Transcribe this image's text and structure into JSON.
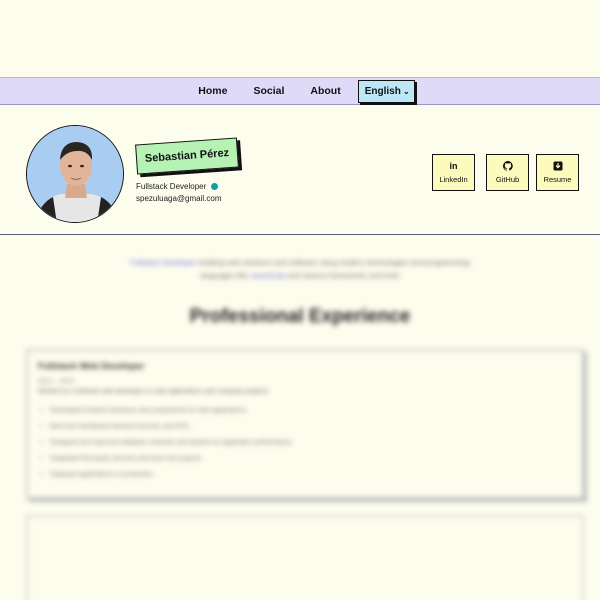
{
  "nav": {
    "links": [
      "Home",
      "Social",
      "About"
    ],
    "language": {
      "selected": "English",
      "icon": "chevron-down-icon"
    }
  },
  "profile": {
    "name": "Sebastian Pérez",
    "role": "Fullstack Developer",
    "email": "spezuluaga@gmail.com",
    "status_color": "#1a9aa1"
  },
  "social": [
    {
      "label": "LinkedIn",
      "icon": "linkedin-icon"
    },
    {
      "label": "GitHub",
      "icon": "github-icon"
    },
    {
      "label": "Resume",
      "icon": "download-icon"
    }
  ],
  "intro": {
    "link_text": "Fullstack Developer",
    "text": "building web solutions and software using modern technologies and programming",
    "text2": "languages like",
    "link2": "JavaScript",
    "text3": "and various frameworks and tools"
  },
  "experience": {
    "title": "Professional Experience",
    "jobs": [
      {
        "title": "Fullstack Web Developer",
        "dates": "2021 – 2023",
        "description": "Worked as a fullstack web developer on web applications and company projects.",
        "bullets": [
          "Developed frontend interfaces and components for web applications.",
          "Built and maintained backend services and APIs.",
          "Designed and improved database schemas and queries for application performance.",
          "Integrated third-party services and tools into projects.",
          "Deployed applications to production."
        ]
      }
    ]
  },
  "colors": {
    "background": "#fdfdee",
    "nav": "#dedaf7",
    "language_button": "#bde7f7",
    "name_badge": "#b6f2b4",
    "social_button": "#fdfabd",
    "link": "#6b63d8"
  }
}
